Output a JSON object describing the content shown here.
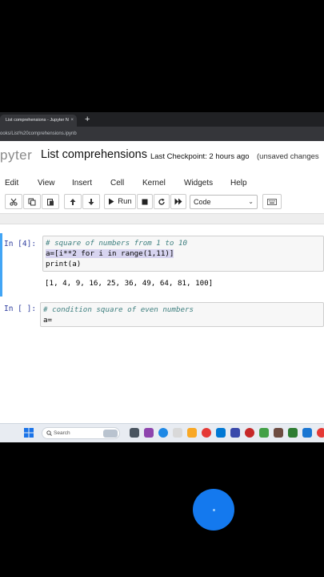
{
  "browser": {
    "tab_title": "List comprehensions - Jupyter N",
    "tab_close": "×",
    "new_tab": "+",
    "url": "ooks/List%20comprehensions.ipynb"
  },
  "header": {
    "logo": "pyter",
    "notebook_title": "List comprehensions",
    "checkpoint": "Last Checkpoint: 2 hours ago",
    "unsaved": "(unsaved changes"
  },
  "menu": {
    "items": [
      {
        "label": "Edit"
      },
      {
        "label": "View"
      },
      {
        "label": "Insert"
      },
      {
        "label": "Cell"
      },
      {
        "label": "Kernel"
      },
      {
        "label": "Widgets"
      },
      {
        "label": "Help"
      }
    ]
  },
  "toolbar": {
    "run_label": "Run",
    "cell_type": "Code",
    "cell_type_chevron": "⌄"
  },
  "cells": [
    {
      "prompt": "In [4]:",
      "lines": [
        "# square of numbers from 1 to 10",
        "a=[i**2 for i in range(1,11)]",
        "print(a)"
      ],
      "output": "[1, 4, 9, 16, 25, 36, 49, 64, 81, 100]"
    },
    {
      "prompt": "In [ ]:",
      "lines": [
        "# condition square of even numbers",
        "a="
      ]
    }
  ],
  "taskbar": {
    "search_placeholder": "Search"
  },
  "colors": {
    "accent": "#42a5f5",
    "touch_dot": "#1479ee",
    "prompt_in": "#303f9f"
  }
}
